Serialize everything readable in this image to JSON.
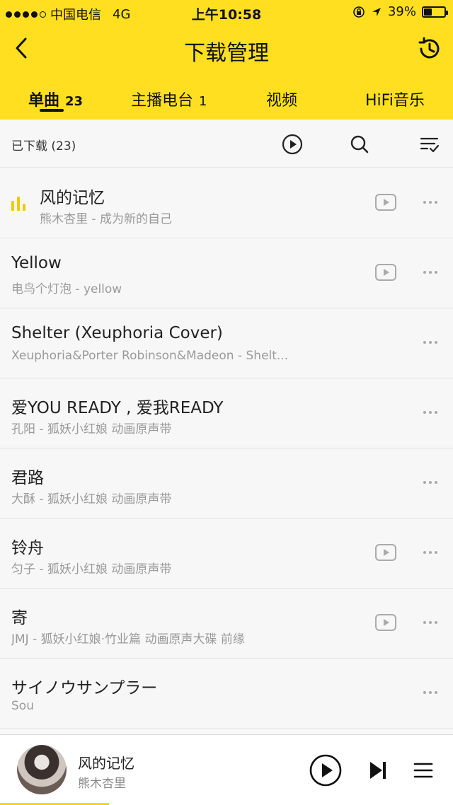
{
  "status_bar": {
    "carrier": "中国电信",
    "network": "4G",
    "time": "上午10:58",
    "battery": "39%",
    "battery_level": 0.39
  },
  "nav": {
    "title": "下载管理"
  },
  "tabs": [
    {
      "label": "单曲",
      "count": "23",
      "active": true
    },
    {
      "label": "主播电台",
      "count": "1",
      "active": false
    },
    {
      "label": "视频",
      "count": "",
      "active": false
    },
    {
      "label": "HiFi音乐",
      "count": "",
      "active": false
    }
  ],
  "toolbar": {
    "label": "已下载 (23)"
  },
  "songs": [
    {
      "title": "风的记忆",
      "subtitle": "熊木杏里 - 成为新的自己",
      "has_mv": true,
      "playing": true
    },
    {
      "title": "Yellow",
      "subtitle": "电鸟个灯泡 - yellow",
      "has_mv": true,
      "playing": false
    },
    {
      "title": "Shelter (Xeuphoria Cover)",
      "subtitle": "Xeuphoria&Porter Robinson&Madeon - Shelt...",
      "has_mv": false,
      "playing": false
    },
    {
      "title": "爱YOU READY , 爱我READY",
      "subtitle": "孔阳 - 狐妖小红娘 动画原声带",
      "has_mv": false,
      "playing": false
    },
    {
      "title": "君路",
      "subtitle": "大酥 - 狐妖小红娘 动画原声带",
      "has_mv": false,
      "playing": false
    },
    {
      "title": "铃舟",
      "subtitle": "匀子 - 狐妖小红娘 动画原声带",
      "has_mv": true,
      "playing": false
    },
    {
      "title": "寄",
      "subtitle": "JMJ - 狐妖小红娘·竹业篇 动画原声大碟 前缘",
      "has_mv": true,
      "playing": false
    },
    {
      "title": "サイノウサンプラー",
      "subtitle": "Sou",
      "has_mv": false,
      "playing": false
    }
  ],
  "player": {
    "title": "风的记忆",
    "artist": "熊木杏里",
    "progress": 0.24
  },
  "colors": {
    "accent": "#ffdf1f",
    "playing_indicator": "#f3c900"
  }
}
